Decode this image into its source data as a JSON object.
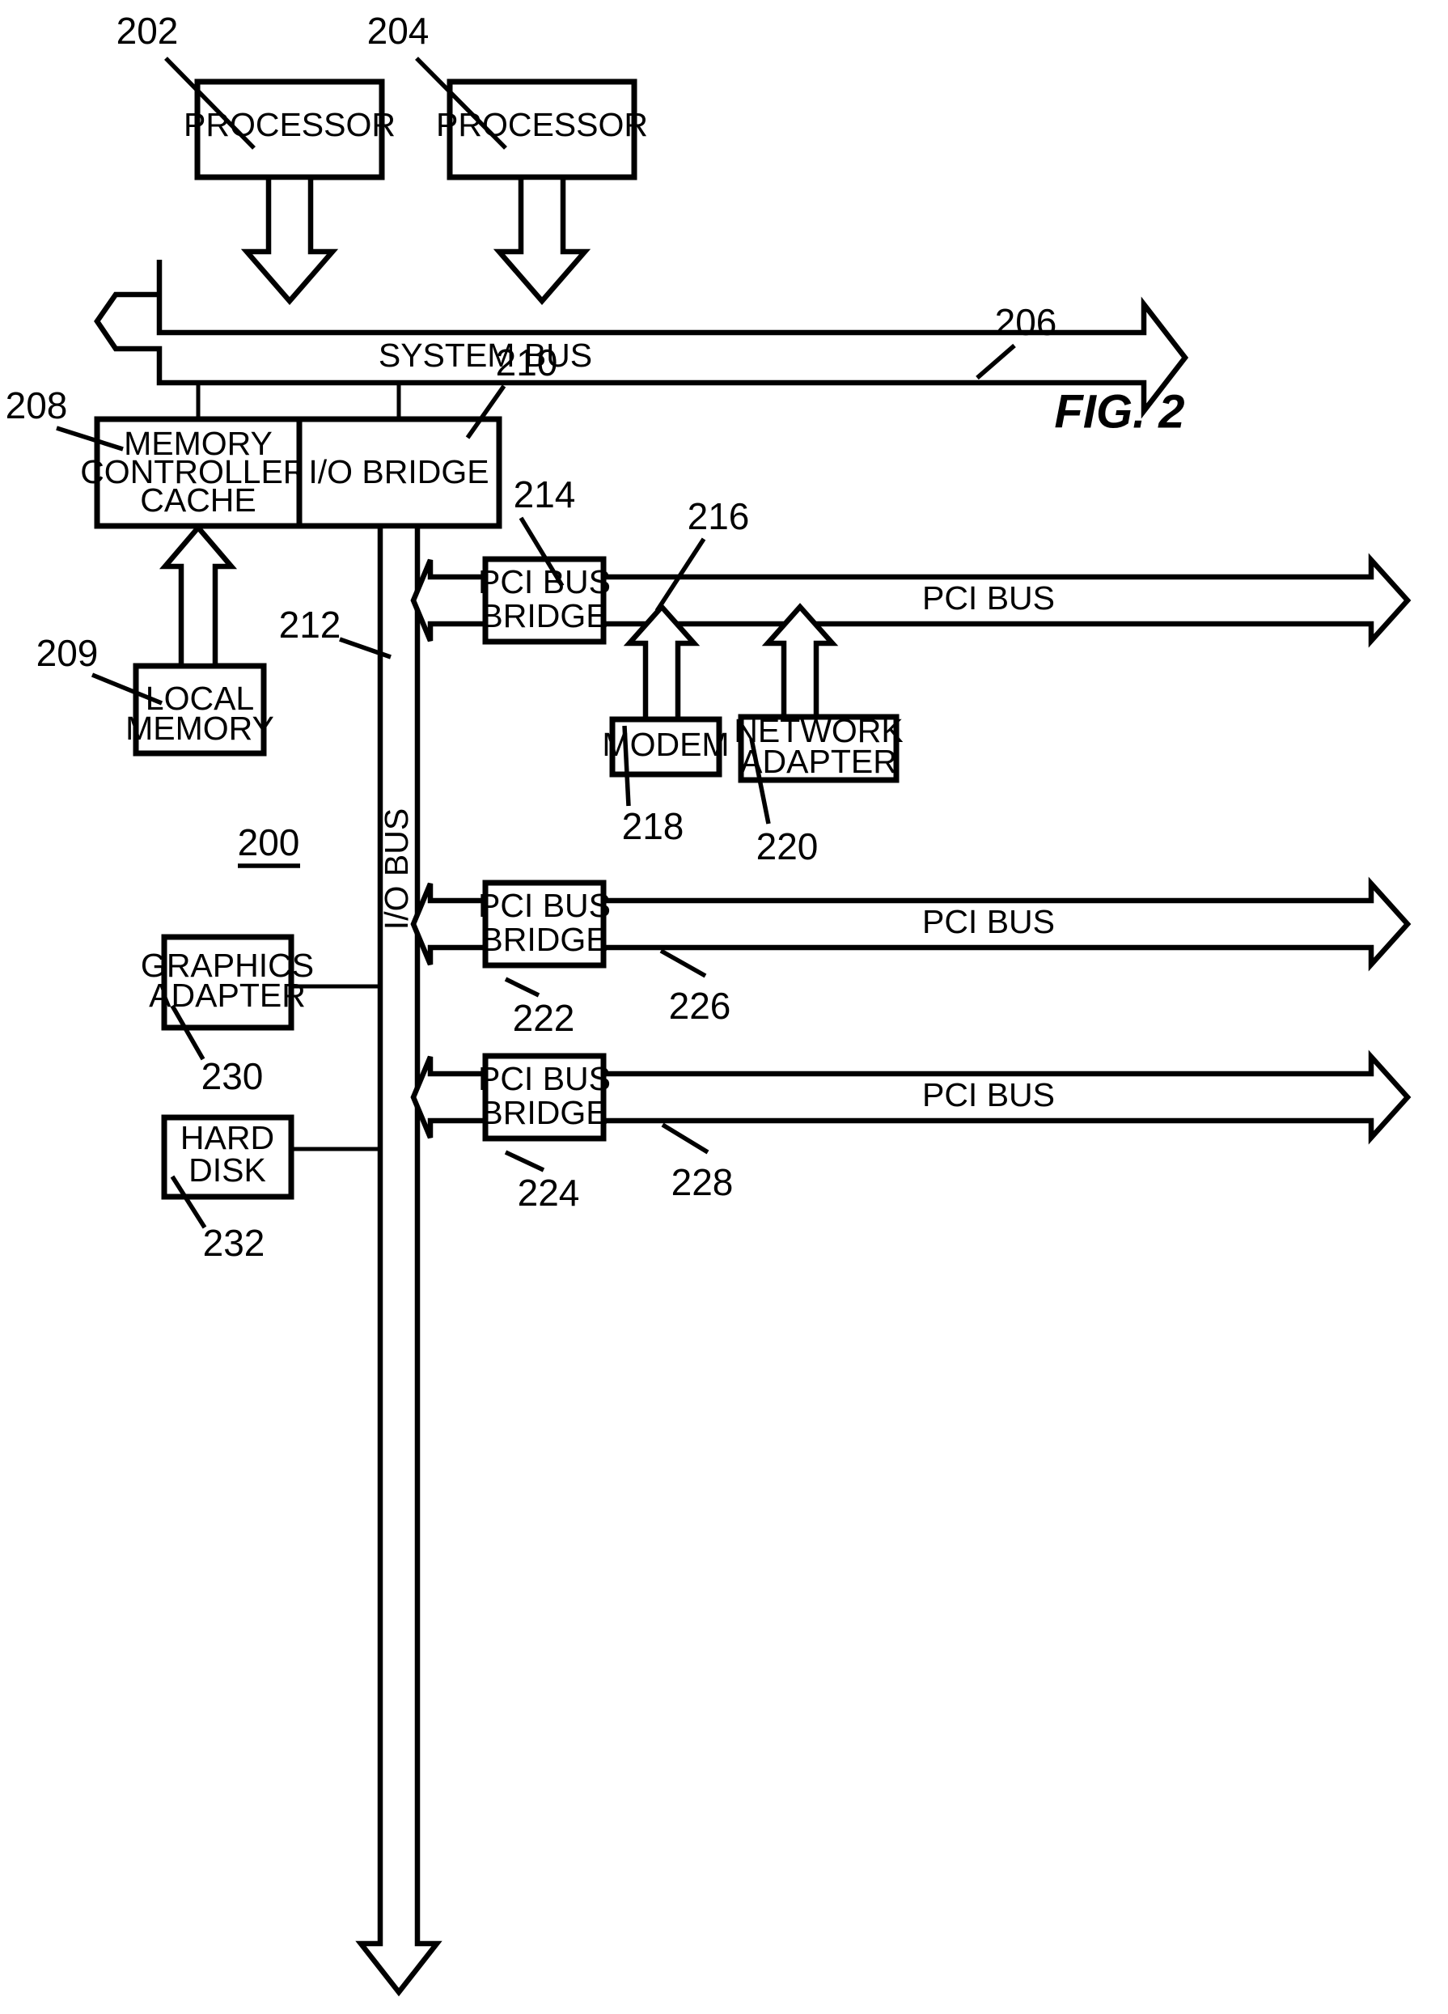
{
  "figure": {
    "title": "FIG. 2",
    "system_ref": "200"
  },
  "boxes": {
    "processor1": {
      "label": "PROCESSOR",
      "ref": "202"
    },
    "processor2": {
      "label": "PROCESSOR",
      "ref": "204"
    },
    "memory_controller": {
      "line1": "MEMORY",
      "line2": "CONTROLLER/",
      "line3": "CACHE",
      "ref": "208"
    },
    "io_bridge": {
      "label": "I/O BRIDGE",
      "ref": "210"
    },
    "local_memory": {
      "line1": "LOCAL",
      "line2": "MEMORY",
      "ref": "209"
    },
    "pci_bridge1": {
      "line1": "PCI BUS",
      "line2": "BRIDGE",
      "ref": "214"
    },
    "pci_bridge2": {
      "line1": "PCI BUS",
      "line2": "BRIDGE",
      "ref": "222"
    },
    "pci_bridge3": {
      "line1": "PCI BUS",
      "line2": "BRIDGE",
      "ref": "224"
    },
    "modem": {
      "label": "MODEM",
      "ref": "218"
    },
    "network_adapter": {
      "line1": "NETWORK",
      "line2": "ADAPTER",
      "ref": "220"
    },
    "graphics_adapter": {
      "line1": "GRAPHICS",
      "line2": "ADAPTER",
      "ref": "230"
    },
    "hard_disk": {
      "line1": "HARD",
      "line2": "DISK",
      "ref": "232"
    }
  },
  "buses": {
    "system_bus": {
      "label": "SYSTEM BUS",
      "ref": "206"
    },
    "io_bus": {
      "label": "I/O BUS",
      "ref": "212"
    },
    "pci_bus1": {
      "label": "PCI BUS",
      "ref": "216"
    },
    "pci_bus2": {
      "label": "PCI BUS",
      "ref": "226"
    },
    "pci_bus3": {
      "label": "PCI BUS",
      "ref": "228"
    }
  },
  "colors": {
    "ink": "#000000",
    "paper": "#ffffff"
  }
}
